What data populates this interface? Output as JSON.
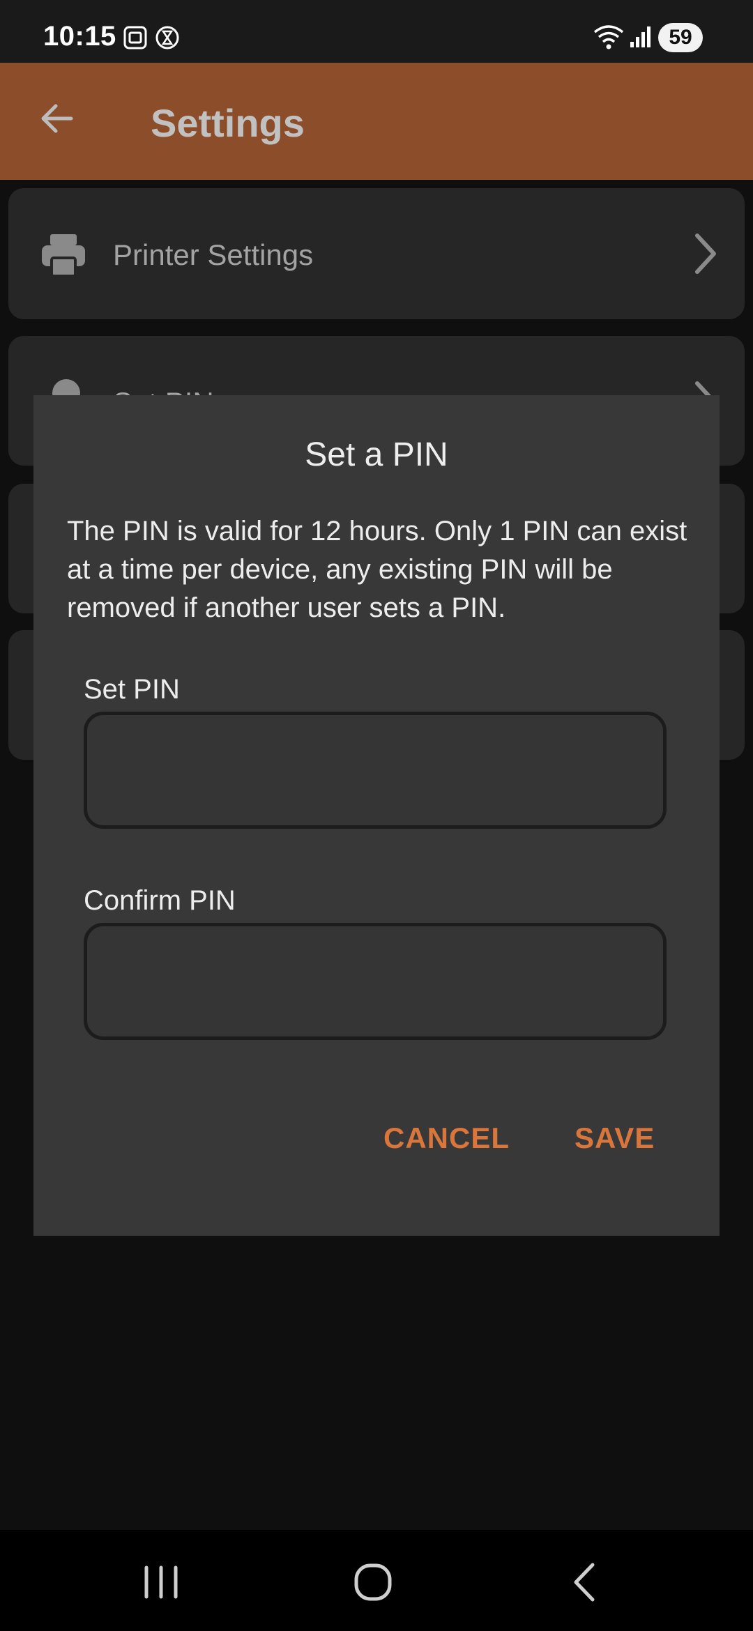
{
  "status_bar": {
    "time": "10:15",
    "battery": "59",
    "icons": [
      "screenshot-icon",
      "timer-icon",
      "wifi-icon",
      "signal-icon"
    ]
  },
  "app_bar": {
    "title": "Settings",
    "back_icon": "arrow-back-icon"
  },
  "settings_list": {
    "items": [
      {
        "label": "Printer Settings",
        "icon": "printer-icon"
      },
      {
        "label": "Set PIN",
        "icon": "key-icon"
      }
    ]
  },
  "dialog": {
    "title": "Set a PIN",
    "message": "The PIN is valid for 12 hours. Only 1 PIN can exist at a time per device, any existing PIN will be removed if another user sets a PIN.",
    "set_pin_label": "Set PIN",
    "set_pin_value": "",
    "confirm_pin_label": "Confirm PIN",
    "confirm_pin_value": "",
    "cancel_label": "CANCEL",
    "save_label": "SAVE"
  },
  "colors": {
    "app_bar": "#8c4e2a",
    "accent": "#d8763c",
    "dialog_bg": "#383838"
  }
}
